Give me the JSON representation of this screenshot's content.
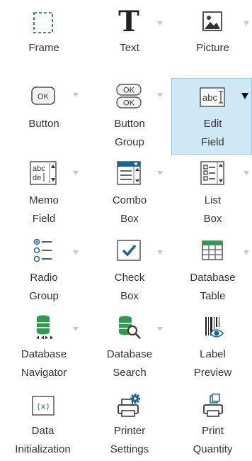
{
  "toolbox": {
    "items": [
      {
        "id": "frame",
        "label": "Frame",
        "icon": "frame-icon",
        "has_dropdown": false
      },
      {
        "id": "text",
        "label": "Text",
        "icon": "text-icon",
        "has_dropdown": true
      },
      {
        "id": "picture",
        "label": "Picture",
        "icon": "picture-icon",
        "has_dropdown": true
      },
      {
        "id": "button",
        "label": "Button",
        "icon": "button-icon",
        "has_dropdown": true
      },
      {
        "id": "button-group",
        "label": "Button\nGroup",
        "icon": "button-group-icon",
        "has_dropdown": true
      },
      {
        "id": "edit-field",
        "label": "Edit\nField",
        "icon": "edit-field-icon",
        "has_dropdown": true,
        "selected": true
      },
      {
        "id": "memo-field",
        "label": "Memo\nField",
        "icon": "memo-field-icon",
        "has_dropdown": true
      },
      {
        "id": "combo-box",
        "label": "Combo\nBox",
        "icon": "combo-box-icon",
        "has_dropdown": true
      },
      {
        "id": "list-box",
        "label": "List\nBox",
        "icon": "list-box-icon",
        "has_dropdown": true
      },
      {
        "id": "radio-group",
        "label": "Radio\nGroup",
        "icon": "radio-group-icon",
        "has_dropdown": true
      },
      {
        "id": "check-box",
        "label": "Check\nBox",
        "icon": "check-box-icon",
        "has_dropdown": true
      },
      {
        "id": "database-table",
        "label": "Database\nTable",
        "icon": "database-table-icon",
        "has_dropdown": true
      },
      {
        "id": "database-navigator",
        "label": "Database\nNavigator",
        "icon": "database-navigator-icon",
        "has_dropdown": true
      },
      {
        "id": "database-search",
        "label": "Database\nSearch",
        "icon": "database-search-icon",
        "has_dropdown": true
      },
      {
        "id": "label-preview",
        "label": "Label\nPreview",
        "icon": "label-preview-icon",
        "has_dropdown": false
      },
      {
        "id": "data-initialization",
        "label": "Data\nInitialization",
        "icon": "data-initialization-icon",
        "has_dropdown": false
      },
      {
        "id": "printer-settings",
        "label": "Printer\nSettings",
        "icon": "printer-settings-icon",
        "has_dropdown": false
      },
      {
        "id": "print-quantity",
        "label": "Print\nQuantity",
        "icon": "print-quantity-icon",
        "has_dropdown": false
      }
    ],
    "icon_glyphs": {
      "text": "T",
      "button": "OK",
      "button_group_top": "OK",
      "button_group_bottom": "OK",
      "edit_field": "abc",
      "memo_field_top": "abc",
      "memo_field_bottom": "de",
      "data_initialization": "(x)"
    }
  },
  "colors": {
    "selected_bg": "#cfe8f6",
    "selected_border": "#98c8e6",
    "accent_blue": "#1e5f9a",
    "accent_green": "#2e9a52",
    "dropdown_arrow": "#c6c6c6"
  }
}
